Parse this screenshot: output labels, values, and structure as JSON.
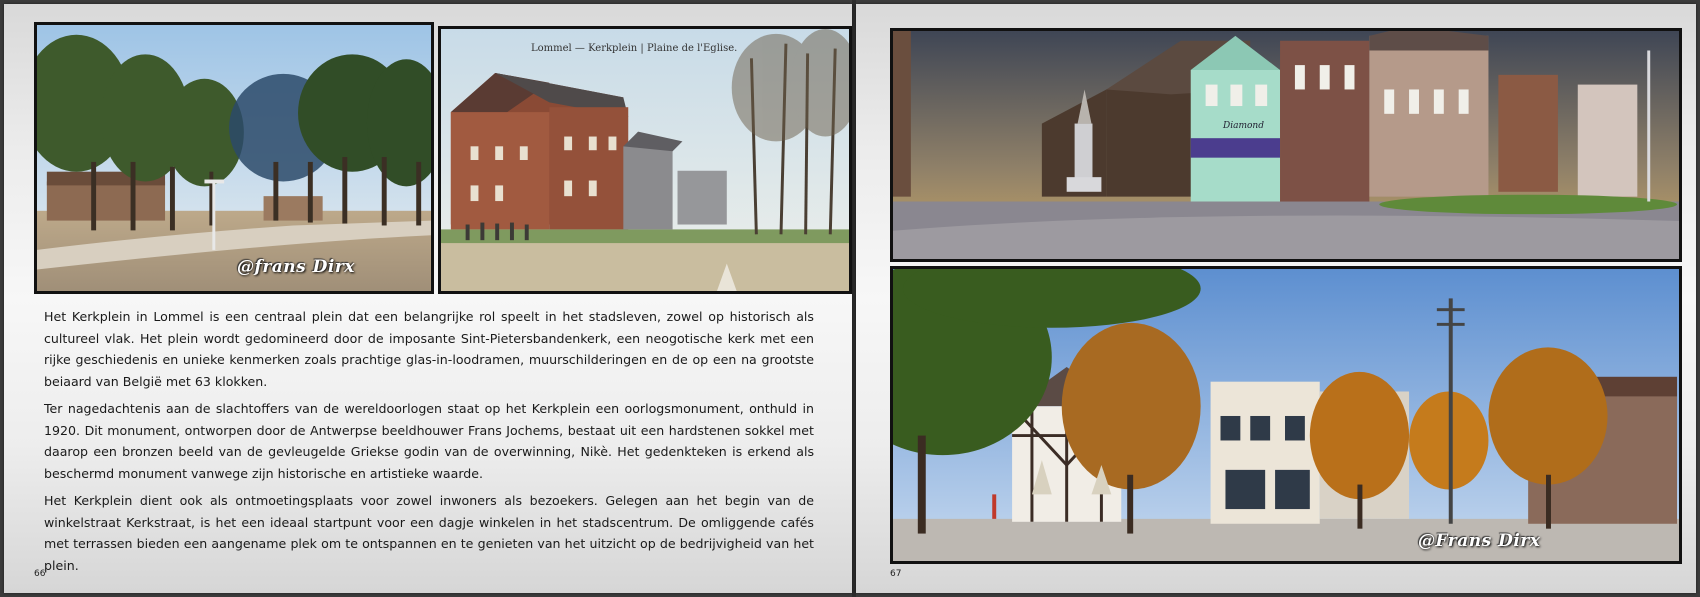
{
  "left_page": {
    "photo1": {
      "watermark": "@frans Dirx"
    },
    "photo2": {
      "caption": "Lommel — Kerkplein | Plaine de l'Eglise."
    },
    "paragraphs": [
      "Het Kerkplein in Lommel is een centraal plein dat een belangrijke rol speelt in het stadsleven, zowel op historisch als cultureel vlak. Het plein wordt gedomineerd door de imposante Sint-Pietersbandenkerk, een neogotische kerk met een rijke geschiedenis en unieke kenmerken zoals prachtige glas-in-loodramen, muurschilderingen en de op een na grootste beiaard van België met 63 klokken.",
      "Ter nagedachtenis aan de slachtoffers van de wereldoorlogen staat op het Kerkplein een oorlogsmonument, onthuld in 1920. Dit monument, ontworpen door de Antwerpse beeldhouwer Frans Jochems, bestaat uit een hardstenen sokkel met daarop een bronzen beeld van de gevleugelde Griekse godin van de overwinning, Nikè. Het gedenkteken is erkend als beschermd monument vanwege zijn historische en artistieke waarde.",
      "Het Kerkplein dient ook als ontmoetingsplaats voor zowel inwoners als bezoekers. Gelegen aan het begin van de winkelstraat Kerkstraat, is het een ideaal startpunt voor een dagje winkelen in het stadscentrum. De omliggende cafés met terrassen bieden een aangename plek om te ontspannen en te genieten van het uitzicht op de bedrijvigheid van het plein."
    ],
    "page_number": "66"
  },
  "right_page": {
    "photo_top": {
      "shop_sign": "Diamond"
    },
    "photo_bottom": {
      "watermark": "@Frans Dirx"
    },
    "page_number": "67"
  }
}
